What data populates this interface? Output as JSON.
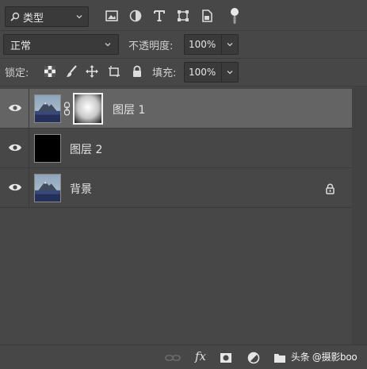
{
  "filter": {
    "kind_label": "类型",
    "icons": [
      "search-icon",
      "pixel-filter-icon",
      "adjustment-filter-icon",
      "type-filter-icon",
      "shape-filter-icon",
      "smart-object-filter-icon",
      "filter-toggle"
    ]
  },
  "blend": {
    "mode": "正常",
    "opacity_label": "不透明度:",
    "opacity_value": "100%"
  },
  "lock": {
    "label": "锁定:",
    "icons": [
      "lock-transparent-pixels-icon",
      "lock-image-pixels-icon",
      "lock-position-icon",
      "lock-artboard-icon",
      "lock-all-icon"
    ],
    "fill_label": "填充:",
    "fill_value": "100%"
  },
  "layers": [
    {
      "name": "图层 1",
      "selected": true,
      "has_mask": true,
      "visible": true,
      "locked": false
    },
    {
      "name": "图层 2",
      "selected": false,
      "has_mask": false,
      "visible": true,
      "locked": false
    },
    {
      "name": "背景",
      "selected": false,
      "has_mask": false,
      "visible": true,
      "locked": true
    }
  ],
  "bottom_bar": {
    "icons": [
      "link-layers-icon",
      "fx-icon",
      "add-mask-icon",
      "adjustment-layer-icon",
      "new-group-icon"
    ],
    "fx_label": "fx",
    "watermark": "头条 @摄影boo"
  },
  "colors": {
    "panel_bg": "#474747",
    "selected_row": "#646464",
    "field_bg": "#3a3a3a"
  }
}
